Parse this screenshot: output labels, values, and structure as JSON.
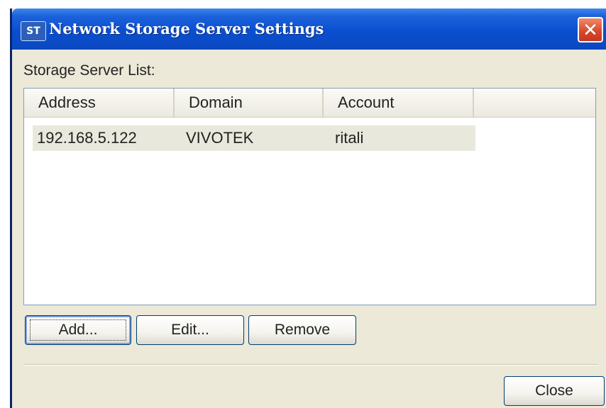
{
  "window": {
    "title": "Network Storage Server Settings",
    "app_icon_text": "ST",
    "close_glyph": "✕"
  },
  "list": {
    "label": "Storage Server List:",
    "columns": [
      "Address",
      "Domain",
      "Account"
    ],
    "rows": [
      {
        "address": "192.168.5.122",
        "domain": "VIVOTEK",
        "account": "ritali"
      }
    ]
  },
  "buttons": {
    "add": "Add...",
    "edit": "Edit...",
    "remove": "Remove",
    "close": "Close"
  },
  "colors": {
    "titlebar": "#0a4fd0",
    "window_bg": "#ece9d8",
    "close_button": "#d8452a"
  }
}
